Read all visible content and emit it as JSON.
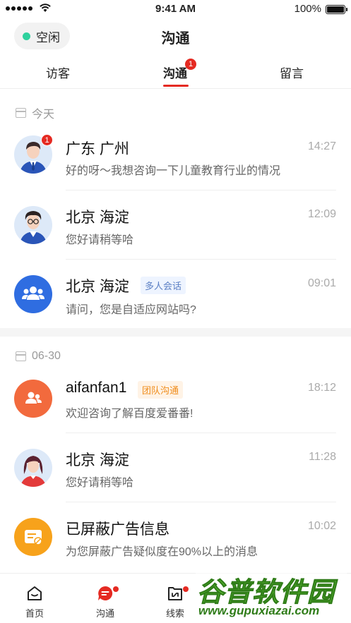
{
  "status": {
    "time": "9:41 AM",
    "battery": "100%"
  },
  "header": {
    "status_label": "空闲",
    "title": "沟通"
  },
  "tabs": [
    {
      "label": "访客"
    },
    {
      "label": "沟通",
      "badge": "1"
    },
    {
      "label": "留言"
    }
  ],
  "sections": [
    {
      "label": "今天"
    },
    {
      "label": "06-30"
    }
  ],
  "conversations": [
    {
      "name": "广东 广州",
      "message": "好的呀～我想咨询一下儿童教育行业的情况",
      "time": "14:27",
      "badge": "1"
    },
    {
      "name": "北京 海淀",
      "message": "您好请稍等哈",
      "time": "12:09"
    },
    {
      "name": "北京 海淀",
      "tag": "多人会话",
      "message": "请问，您是自适应网站吗?",
      "time": "09:01"
    },
    {
      "name": "aifanfan1",
      "tag": "团队沟通",
      "message": "欢迎咨询了解百度爱番番!",
      "time": "18:12"
    },
    {
      "name": "北京 海淀",
      "message": "您好请稍等哈",
      "time": "11:28"
    },
    {
      "name": "已屏蔽广告信息",
      "message": "为您屏蔽广告疑似度在90%以上的消息",
      "time": "10:02"
    }
  ],
  "bottom_nav": [
    {
      "label": "首页"
    },
    {
      "label": "沟通"
    },
    {
      "label": "线索"
    }
  ],
  "watermark": {
    "title": "谷普软件园",
    "url": "www.gupuxiazai.com"
  },
  "colors": {
    "accent": "#e52a22",
    "online": "#2ed19d",
    "group_blue": "#2f6de1",
    "team_orange": "#f26a3d",
    "ad_orange": "#f7a21b"
  }
}
